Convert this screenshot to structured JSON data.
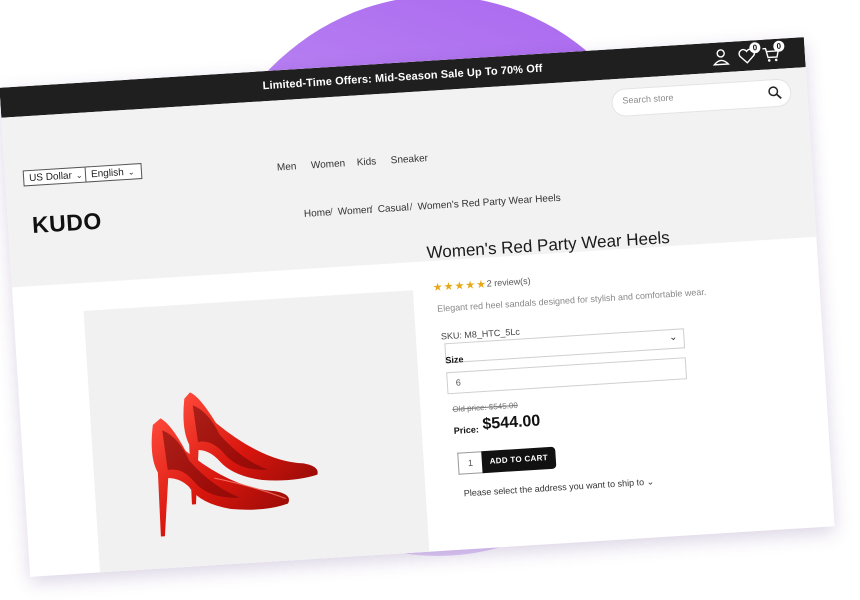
{
  "promo": {
    "text": "Limited-Time Offers: Mid-Season Sale Up To 70% Off"
  },
  "header_icons": {
    "wishlist_count": "0",
    "cart_count": "0"
  },
  "search": {
    "placeholder": "Search store"
  },
  "currency": {
    "selected": "US Dollar"
  },
  "language": {
    "selected": "English"
  },
  "nav": {
    "items": [
      "Men",
      "Women",
      "Kids",
      "Sneaker"
    ]
  },
  "logo": {
    "text": "KUDO"
  },
  "breadcrumb": {
    "items": [
      "Home",
      "Women",
      "Casual",
      "Women's Red Party Wear Heels"
    ],
    "separator": "/"
  },
  "product": {
    "title": "Women's Red Party Wear Heels",
    "rating": 4.5,
    "stars": "★★★★★",
    "reviews": "2 review(s)",
    "description": "Elegant red heel sandals designed for stylish and comfortable wear.",
    "sku": "SKU: M8_HTC_5Lc",
    "size_label": "Size",
    "size_value": "6",
    "old_price": "Old price: $545.00",
    "price_label": "Price:",
    "price": "$544.00",
    "quantity": "1",
    "add_to_cart": "ADD TO CART",
    "ship_text": "Please select the address you want to ship to"
  },
  "colors": {
    "accent_purple": "#a965ef",
    "dark": "#1f1f1f",
    "shoe_red": "#d21a12"
  }
}
